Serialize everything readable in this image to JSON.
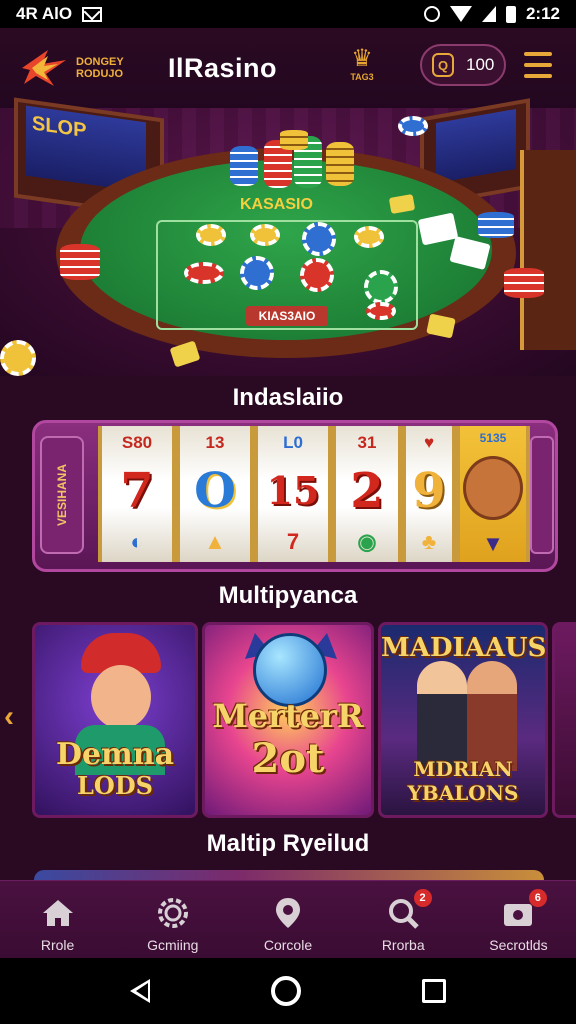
{
  "status_bar": {
    "carrier": "4R AlO",
    "time": "2:12"
  },
  "header": {
    "logo_text_line1": "DONGEY",
    "logo_text_line2": "RODUJO",
    "title": "IlRasino",
    "crown_label": "TAG3",
    "coin_icon_letter": "Q",
    "coin_value": "100"
  },
  "hero": {
    "table_label": "KASASIO",
    "table_plate": "KIAS3AIO",
    "slot_screen_left": "SLOP",
    "chip_colors": [
      "#d8342a",
      "#2f6fd2",
      "#f0c23a",
      "#2aa34c",
      "#ffffff"
    ]
  },
  "sections": {
    "slots_title": "Indaslaiio",
    "multiplayer_title": "Multipyanca",
    "bottom_title": "Maltip Ryeilud"
  },
  "slot_machine": {
    "side_text": "VESIHANA",
    "reels": [
      {
        "top": "S80",
        "mid": "7",
        "bot": "◐"
      },
      {
        "top": "13",
        "mid": "O",
        "bot": "▲"
      },
      {
        "top": "L0",
        "mid": "15",
        "bot": "7"
      },
      {
        "top": "31",
        "mid": "2",
        "bot": "◉"
      },
      {
        "top": "♥",
        "mid": "9",
        "bot": "♣"
      }
    ],
    "gold_reel_top": "5135"
  },
  "games": [
    {
      "title_line1": "Demna",
      "title_line2": "LODS"
    },
    {
      "title_line1": "MerterR",
      "title_line2": "2ot"
    },
    {
      "title_line1": "MADIAAUS",
      "title_line2": "MDRIAN",
      "title_line3": "YBALONS"
    }
  ],
  "bottom_nav": [
    {
      "label": "Rrole",
      "icon": "home-icon",
      "badge": ""
    },
    {
      "label": "Gcmiing",
      "icon": "gear-icon",
      "badge": ""
    },
    {
      "label": "Corcole",
      "icon": "location-icon",
      "badge": ""
    },
    {
      "label": "Rrorba",
      "icon": "search-icon",
      "badge": "2"
    },
    {
      "label": "Secrotlds",
      "icon": "wallet-icon",
      "badge": "6"
    }
  ],
  "colors": {
    "accent": "#e8a839",
    "background": "#2a0a22",
    "nav_bg": "#4a1140",
    "badge": "#d72a2a"
  }
}
